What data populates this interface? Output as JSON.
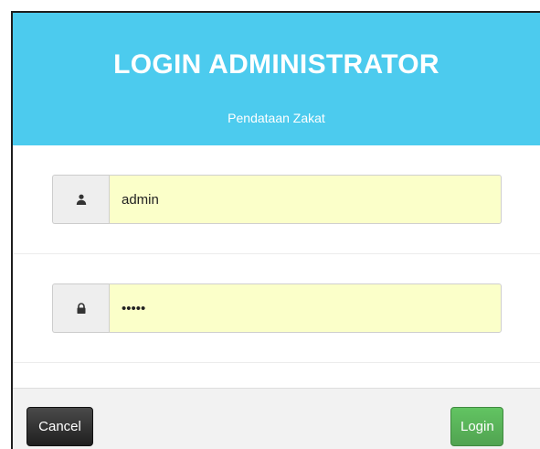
{
  "header": {
    "title": "LOGIN ADMINISTRATOR",
    "subtitle": "Pendataan Zakat"
  },
  "form": {
    "username": {
      "icon": "user-icon",
      "value": "admin"
    },
    "password": {
      "icon": "lock-icon",
      "value": "admin"
    }
  },
  "footer": {
    "cancel_label": "Cancel",
    "login_label": "Login"
  },
  "colors": {
    "header_bg": "#4ccbee",
    "field_bg": "#fbffc9",
    "login_button": "#5bb75b",
    "cancel_button": "#333333"
  }
}
